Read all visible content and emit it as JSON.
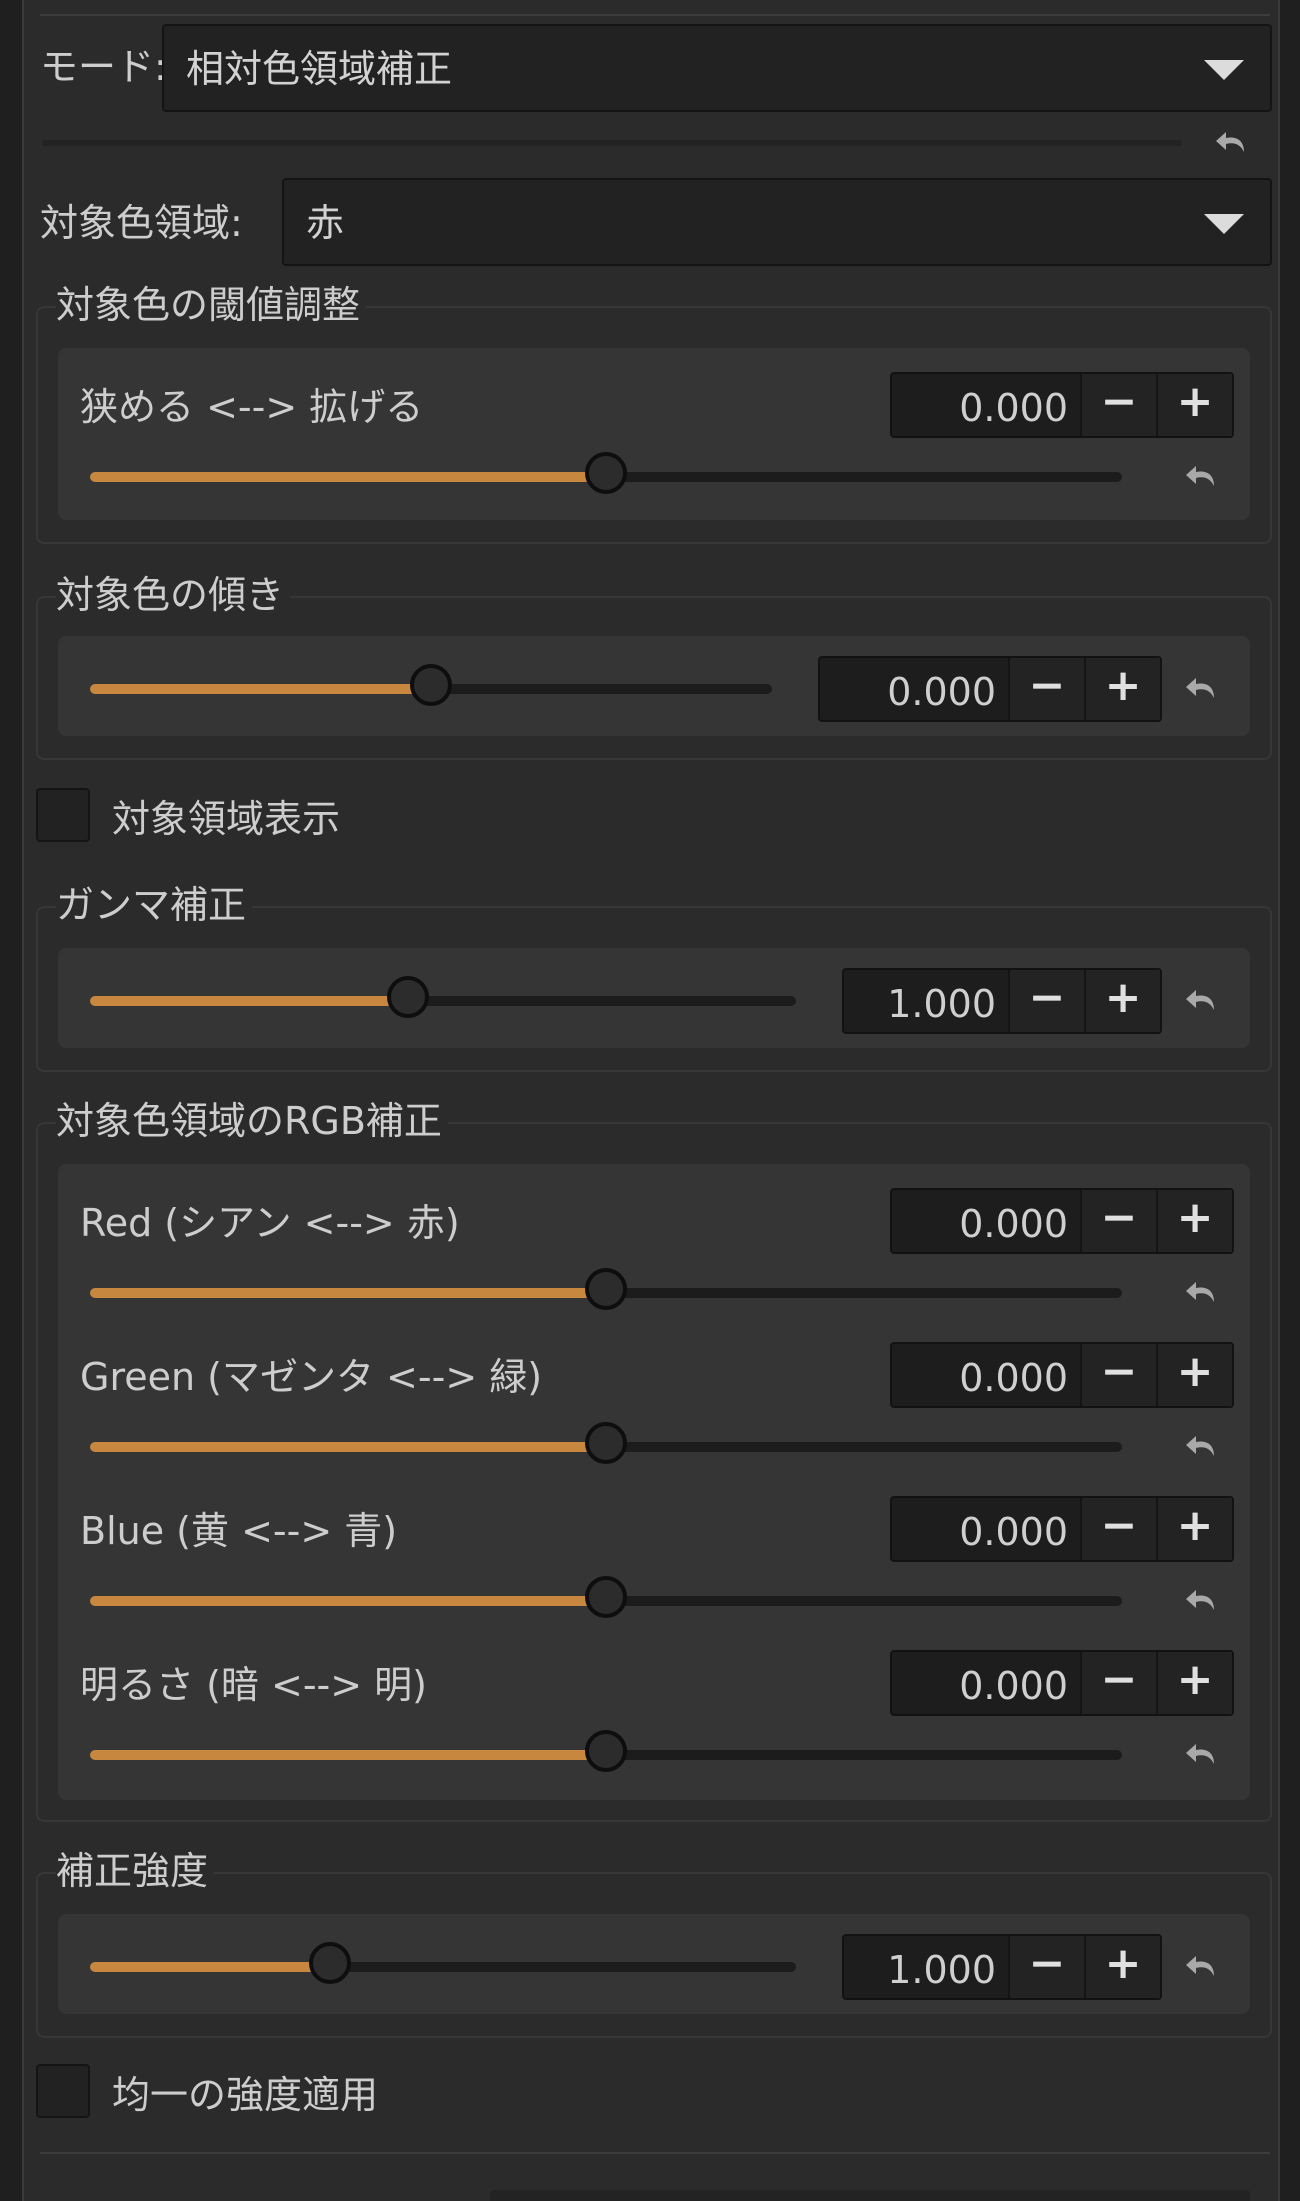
{
  "mode": {
    "label": "モード:",
    "value": "相対色領域補正"
  },
  "target_gamut": {
    "label": "対象色領域:",
    "value": "赤"
  },
  "threshold_group": {
    "title": "対象色の閾値調整",
    "control": {
      "label": "狭める <--> 拡げる",
      "value": "0.000",
      "level": 0.5
    }
  },
  "tilt_group": {
    "title": "対象色の傾き",
    "control": {
      "value": "0.000",
      "level": 0.5
    }
  },
  "show_area": {
    "label": "対象領域表示",
    "checked": false
  },
  "gamma_group": {
    "title": "ガンマ補正",
    "control": {
      "value": "1.000",
      "level": 0.45
    }
  },
  "rgb_group": {
    "title": "対象色領域のRGB補正",
    "controls": [
      {
        "label": "Red (シアン <--> 赤)",
        "value": "0.000",
        "level": 0.5
      },
      {
        "label": "Green (マゼンタ <--> 緑)",
        "value": "0.000",
        "level": 0.5
      },
      {
        "label": "Blue  (黄 <--> 青)",
        "value": "0.000",
        "level": 0.5
      },
      {
        "label": "明るさ  (暗 <--> 明)",
        "value": "0.000",
        "level": 0.5
      }
    ]
  },
  "strength_group": {
    "title": "補正強度",
    "control": {
      "value": "1.000",
      "level": 0.34
    }
  },
  "uniform_strength": {
    "label": "均一の強度適用",
    "checked": false
  },
  "icons": {
    "minus": "minus-icon",
    "plus": "plus-icon",
    "reset": "undo-icon",
    "dropdown": "chevron-down-icon"
  },
  "colors": {
    "accent": "#c8873f",
    "background": "#2b2b2b",
    "panel": "#353535"
  },
  "glyphs": {
    "minus": "−",
    "plus": "+"
  }
}
